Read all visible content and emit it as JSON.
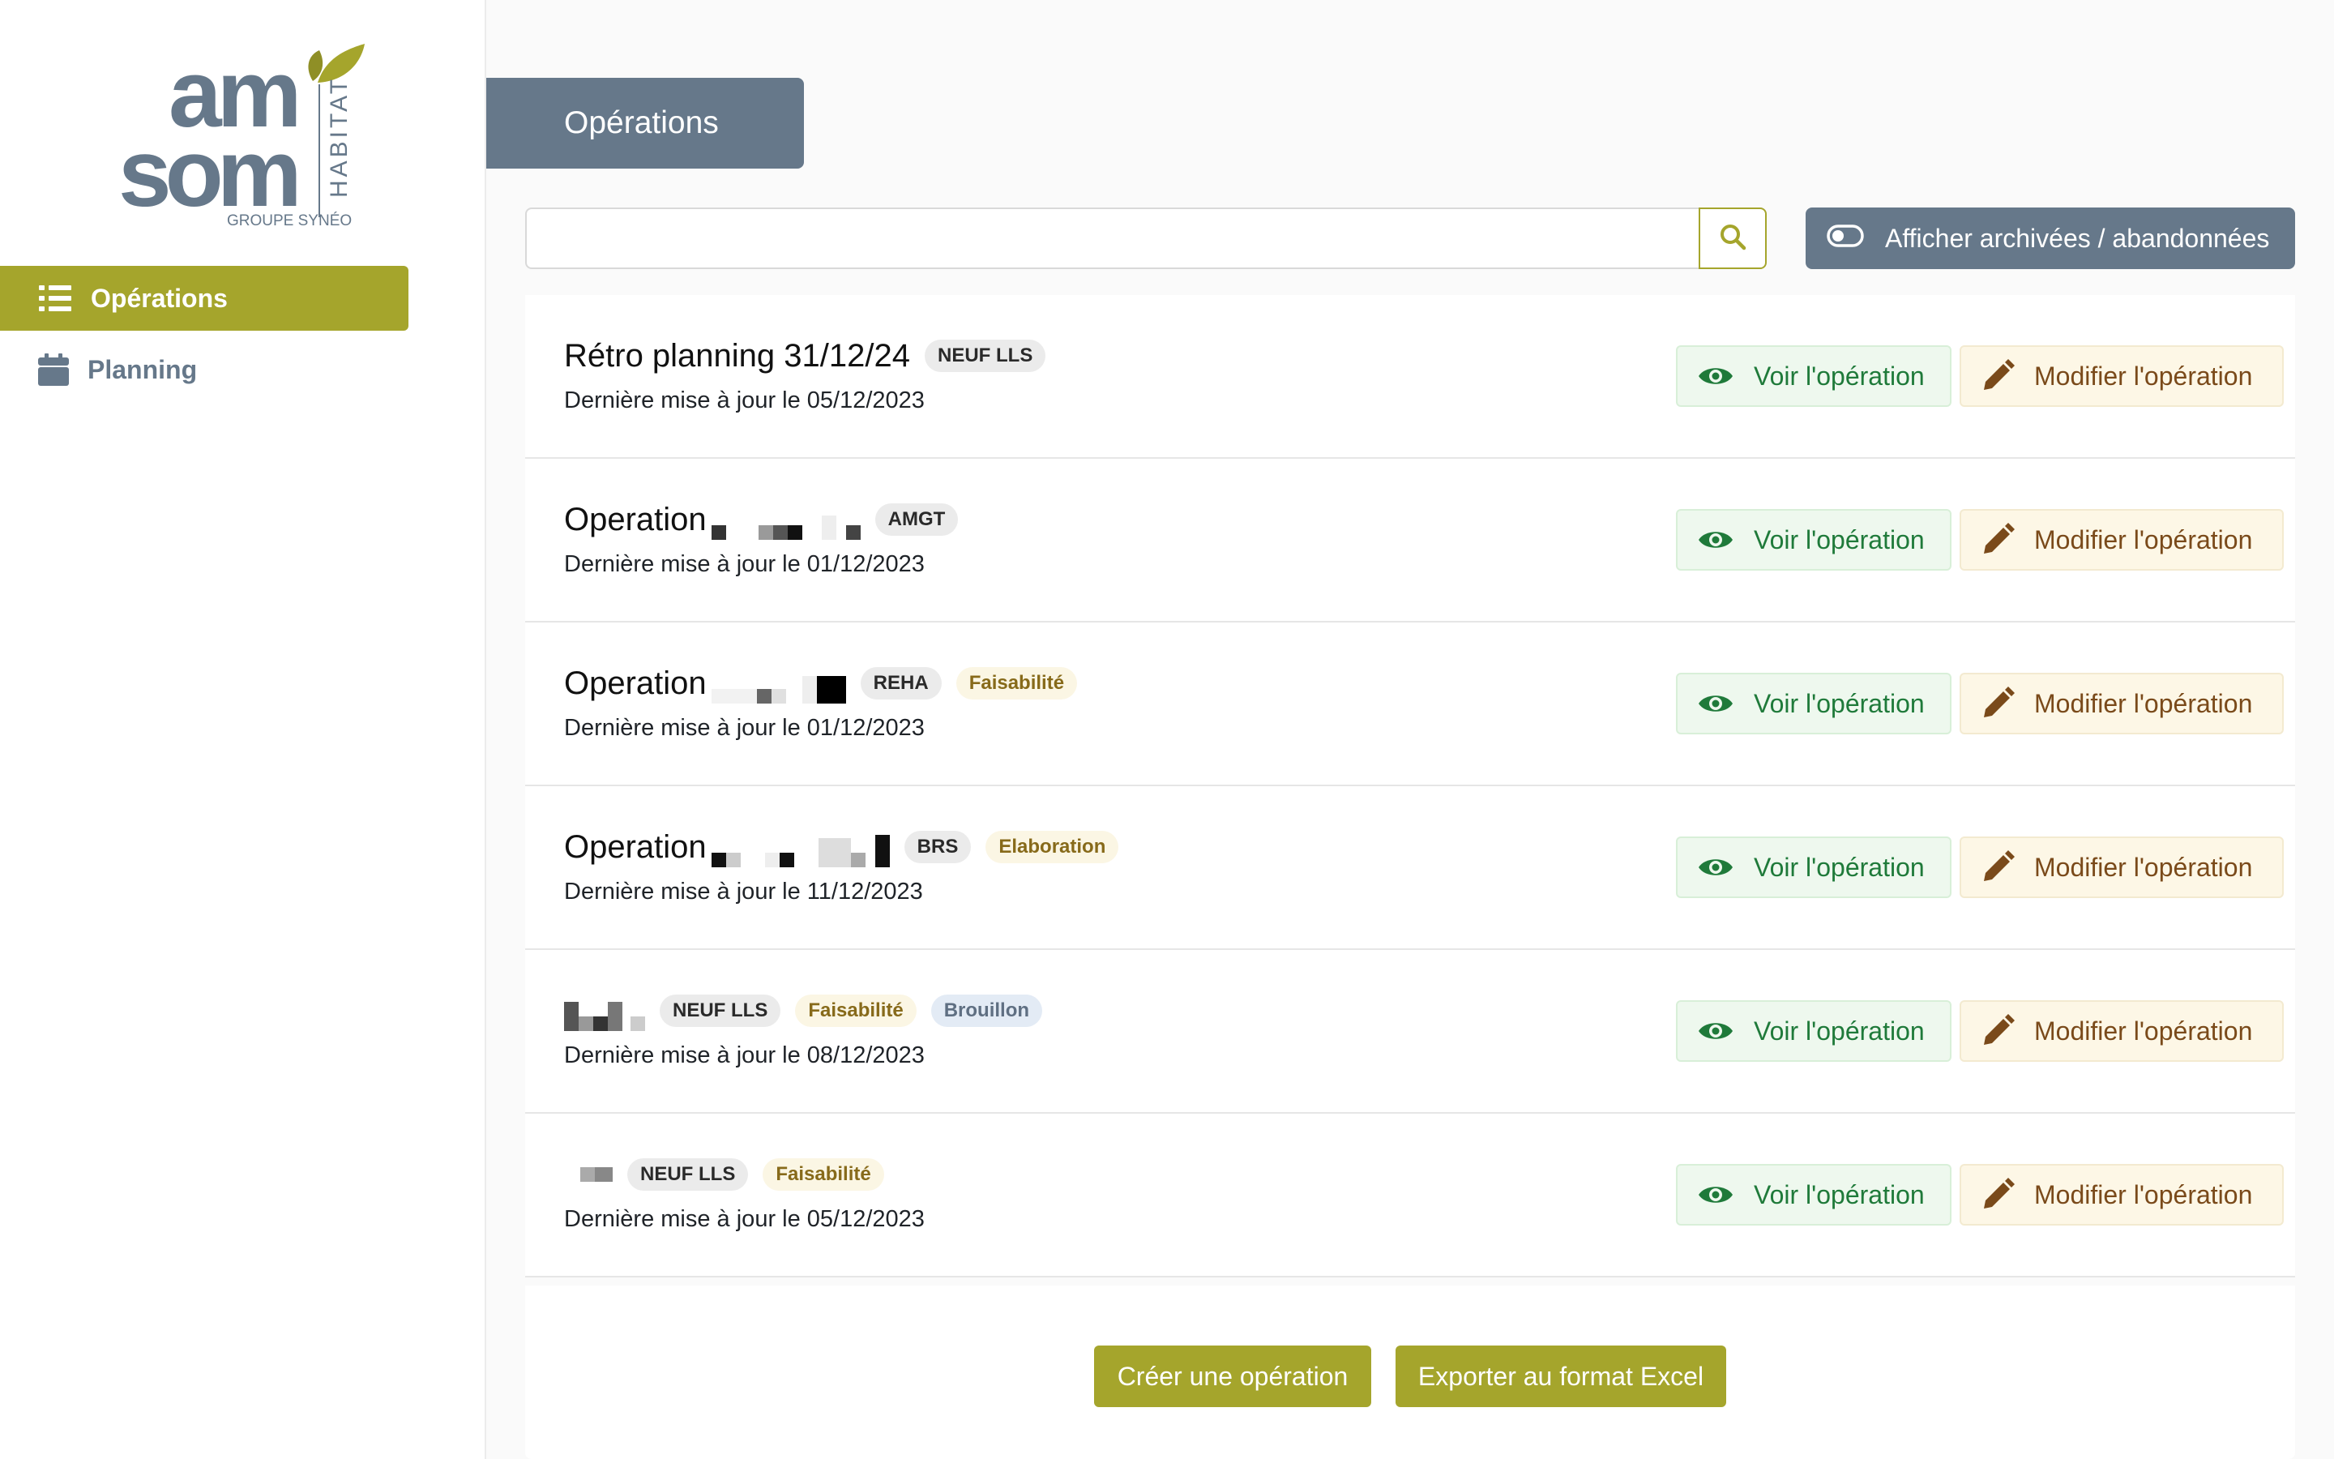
{
  "brand": {
    "logo_line1": "am",
    "logo_line2": "som",
    "logo_vertical": "HABITAT",
    "logo_group": "GROUPE SYNÉO",
    "accent_color": "#a5a52c",
    "slate_color": "#66788a"
  },
  "sidebar": {
    "items": [
      {
        "label": "Opérations",
        "icon": "list-icon",
        "active": true
      },
      {
        "label": "Planning",
        "icon": "calendar-icon",
        "active": false
      }
    ]
  },
  "header": {
    "title": "Opérations"
  },
  "search": {
    "value": "",
    "placeholder": "",
    "icon": "search-icon"
  },
  "archive_toggle": {
    "label": "Afficher archivées / abandonnées",
    "icon": "toggle-off-icon",
    "on": false
  },
  "actions": {
    "view_label": "Voir l'opération",
    "edit_label": "Modifier l'opération"
  },
  "operations": [
    {
      "title": "Rétro planning 31/12/24",
      "type": "NEUF LLS",
      "phase": "",
      "status": "",
      "updated": "Dernière mise à jour le 05/12/2023"
    },
    {
      "title": "Operation",
      "type": "AMGT",
      "phase": "",
      "status": "",
      "updated": "Dernière mise à jour le 01/12/2023"
    },
    {
      "title": "Operation",
      "type": "REHA",
      "phase": "Faisabilité",
      "status": "",
      "updated": "Dernière mise à jour le 01/12/2023"
    },
    {
      "title": "Operation",
      "type": "BRS",
      "phase": "Elaboration",
      "status": "",
      "updated": "Dernière mise à jour le 11/12/2023"
    },
    {
      "title": "",
      "type": "NEUF LLS",
      "phase": "Faisabilité",
      "status": "Brouillon",
      "updated": "Dernière mise à jour le 08/12/2023"
    },
    {
      "title": "",
      "type": "NEUF LLS",
      "phase": "Faisabilité",
      "status": "",
      "updated": "Dernière mise à jour le 05/12/2023"
    }
  ],
  "footer": {
    "create_label": "Créer une opération",
    "export_label": "Exporter au format Excel"
  }
}
